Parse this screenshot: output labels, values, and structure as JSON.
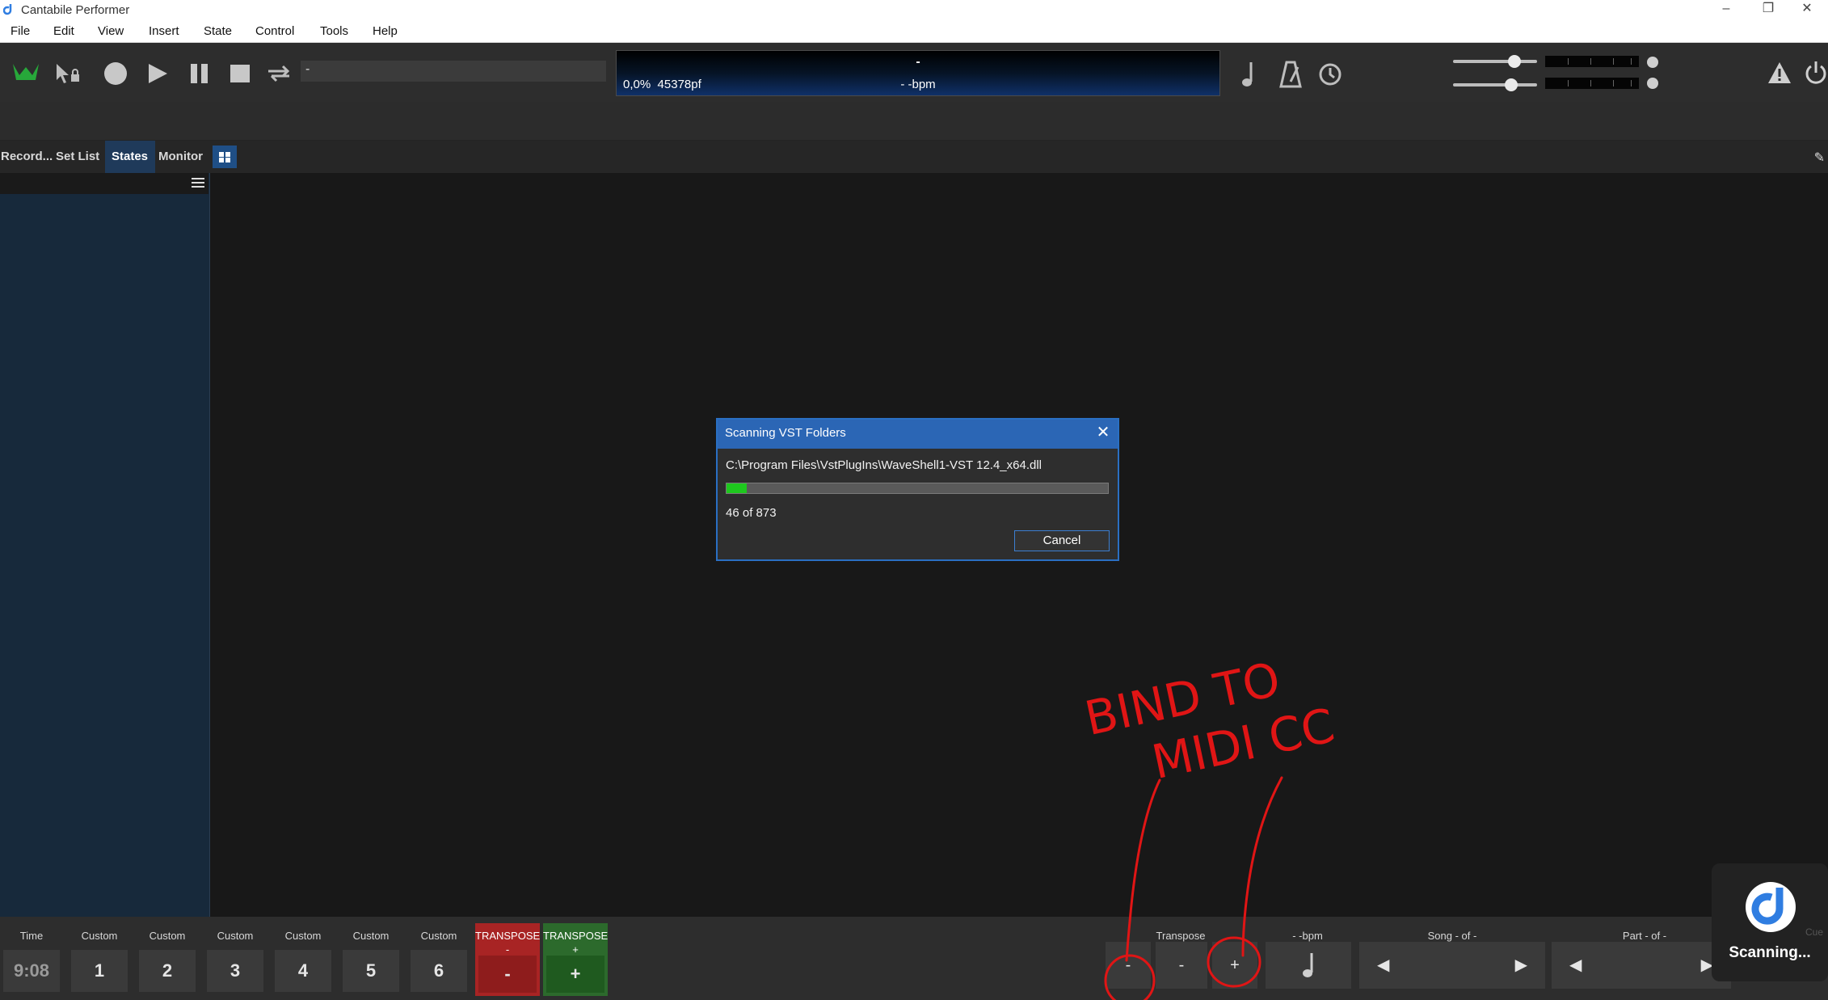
{
  "window": {
    "title": "Cantabile Performer",
    "min": "–",
    "restore": "❐",
    "close": "✕"
  },
  "menu": [
    "File",
    "Edit",
    "View",
    "Insert",
    "State",
    "Control",
    "Tools",
    "Help"
  ],
  "toolbar": {
    "song_field": "-"
  },
  "lcd": {
    "position": "0,0%",
    "sample": "45378pf",
    "top_value": "-",
    "bpm": "- -bpm"
  },
  "tabs": [
    "Record...",
    "Set List",
    "States",
    "Monitor"
  ],
  "active_tab": "States",
  "dialog": {
    "title": "Scanning VST Folders",
    "close": "✕",
    "path": "C:\\Program Files\\VstPlugIns\\WaveShell1-VST 12.4_x64.dll",
    "progress": {
      "current": 46,
      "total": 873
    },
    "count_text": "46 of 873",
    "cancel": "Cancel"
  },
  "bottom": {
    "time_label": "Time",
    "time_value": "9:08",
    "customs": [
      {
        "label": "Custom",
        "value": "1"
      },
      {
        "label": "Custom",
        "value": "2"
      },
      {
        "label": "Custom",
        "value": "3"
      },
      {
        "label": "Custom",
        "value": "4"
      },
      {
        "label": "Custom",
        "value": "5"
      },
      {
        "label": "Custom",
        "value": "6"
      }
    ],
    "transpose_down": {
      "label": "TRANSPOSE",
      "sub": "-",
      "value": "-"
    },
    "transpose_up": {
      "label": "TRANSPOSE",
      "sub": "+",
      "value": "+"
    },
    "transpose_label": "Transpose",
    "transpose_minus": "-",
    "transpose_value": "-",
    "transpose_plus": "+",
    "bpm_label": "- -bpm",
    "song_label": "Song - of -",
    "part_label": "Part - of -",
    "prev": "◀",
    "next": "▶"
  },
  "toast": {
    "text": "Scanning...",
    "behind_text": "Cue"
  },
  "annotation_text": "BIND TO MIDI CC",
  "colors": {
    "accent": "#2b66b5",
    "progress": "#1ec81e",
    "annotation": "#e01515",
    "transpose_down": "#a82424",
    "transpose_up": "#2c6a2c"
  }
}
